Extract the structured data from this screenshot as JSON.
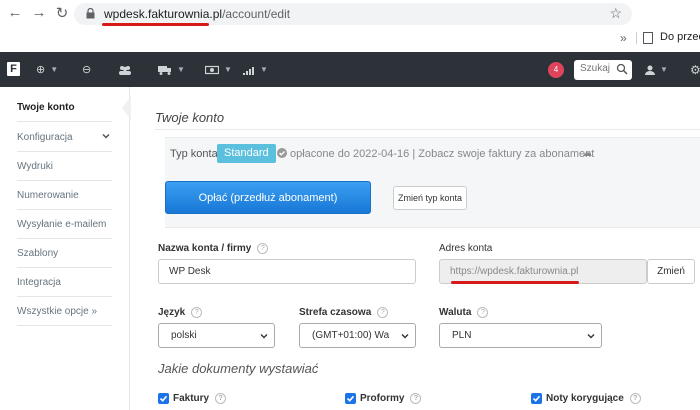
{
  "browser": {
    "url_domain": "wpdesk.fakturownia.pl",
    "url_path": "/account/edit",
    "bookmark_label": "Do przeczy"
  },
  "navbar": {
    "logo": "F",
    "notification_count": "4",
    "search_placeholder": "Szukaj"
  },
  "sidebar": {
    "items": [
      {
        "label": "Twoje konto"
      },
      {
        "label": "Konfiguracja"
      },
      {
        "label": "Wydruki"
      },
      {
        "label": "Numerowanie"
      },
      {
        "label": "Wysyłanie e-mailem"
      },
      {
        "label": "Szablony"
      },
      {
        "label": "Integracja"
      },
      {
        "label": "Wszystkie opcje »"
      }
    ]
  },
  "main": {
    "title": "Twoje konto",
    "account_type_label": "Typ konta",
    "account_type_value": "Standard",
    "paid_text": "opłacone do 2022-04-16 | Zobacz swoje faktury za abonament",
    "pay_button": "Opłać (przedłuż abonament)",
    "change_type_button": "Zmień typ konta",
    "account_name_label": "Nazwa konta / firmy",
    "account_name_value": "WP Desk",
    "account_address_label": "Adres konta",
    "account_address_value": "https://wpdesk.fakturownia.pl",
    "change_address_button": "Zmień",
    "language_label": "Język",
    "language_value": "polski",
    "timezone_label": "Strefa czasowa",
    "timezone_value": "(GMT+01:00) Wa",
    "currency_label": "Waluta",
    "currency_value": "PLN",
    "documents_title": "Jakie dokumenty wystawiać",
    "documents": [
      {
        "label": "Faktury"
      },
      {
        "label": "Proformy"
      },
      {
        "label": "Noty korygujące"
      }
    ]
  },
  "colors": {
    "navbar_bg": "#2c3238",
    "standard_badge": "#5bc0de",
    "pay_button": "#1877d6",
    "highlight_underline": "#d61a1a",
    "checkbox": "#1a73e8"
  }
}
